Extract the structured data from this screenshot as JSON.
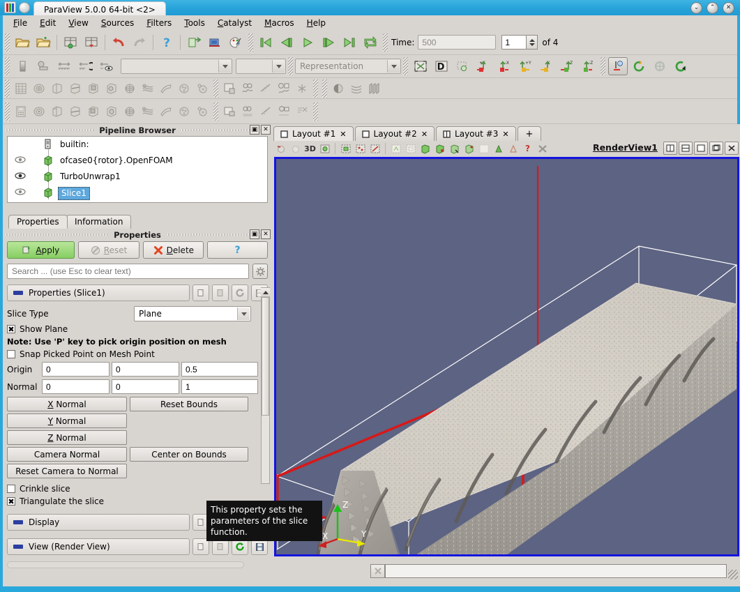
{
  "window": {
    "title": "ParaView 5.0.0 64-bit <2>",
    "buttons": {
      "minimize": "⌄",
      "maximize": "⌃",
      "close": "✕"
    }
  },
  "menu": {
    "items": [
      {
        "label": "File"
      },
      {
        "label": "Edit"
      },
      {
        "label": "View"
      },
      {
        "label": "Sources"
      },
      {
        "label": "Filters"
      },
      {
        "label": "Tools"
      },
      {
        "label": "Catalyst"
      },
      {
        "label": "Macros"
      },
      {
        "label": "Help"
      }
    ]
  },
  "toolbar": {
    "time_label": "Time:",
    "time_value": "500",
    "frame_value": "1",
    "frame_of": "of 4",
    "representation_placeholder": "Representation",
    "array_placeholder": "",
    "component_placeholder": ""
  },
  "pipeline": {
    "title": "Pipeline Browser",
    "items": [
      {
        "label": "builtin:",
        "eye": false,
        "selected": false
      },
      {
        "label": "ofcase0{rotor}.OpenFOAM",
        "eye": true,
        "selected": false
      },
      {
        "label": "TurboUnwrap1",
        "eye": true,
        "selected": false
      },
      {
        "label": "Slice1",
        "eye": true,
        "selected": true
      }
    ]
  },
  "panel_tabs": [
    {
      "label": "Properties",
      "active": true
    },
    {
      "label": "Information",
      "active": false
    }
  ],
  "properties": {
    "title": "Properties",
    "apply_label": "Apply",
    "reset_label": "Reset",
    "delete_label": "Delete",
    "help_label": "?",
    "search_placeholder": "Search ... (use Esc to clear text)",
    "sections": {
      "slice": "Properties (Slice1)",
      "display": "Display",
      "view": "View (Render View)"
    },
    "slice_type_label": "Slice Type",
    "slice_type_value": "Plane",
    "show_plane_label": "Show Plane",
    "show_plane_checked": true,
    "note": "Note: Use 'P' key to pick origin position on mesh",
    "snap_label": "Snap Picked Point on Mesh Point",
    "snap_checked": false,
    "origin_label": "Origin",
    "origin": [
      "0",
      "0",
      "0.5"
    ],
    "normal_label": "Normal",
    "normal": [
      "0",
      "0",
      "1"
    ],
    "buttons": {
      "x_normal": "X Normal",
      "y_normal": "Y Normal",
      "z_normal": "Z Normal",
      "camera_normal": "Camera Normal",
      "reset_camera_to_normal": "Reset Camera to Normal",
      "reset_bounds": "Reset Bounds",
      "center_on_bounds": "Center on Bounds"
    },
    "crinkle_label": "Crinkle slice",
    "crinkle_checked": false,
    "triangulate_label": "Triangulate the slice",
    "triangulate_checked": true
  },
  "tooltip": {
    "text": "This property sets the parameters of the slice function."
  },
  "layout": {
    "tabs": [
      {
        "label": "Layout #1",
        "active": true,
        "close": "✕"
      },
      {
        "label": "Layout #2",
        "active": false,
        "close": "✕"
      },
      {
        "label": "Layout #3",
        "active": false,
        "close": "✕"
      }
    ],
    "add_label": "+",
    "view_toolbar_3d": "3D",
    "view_toolbar_help": "?",
    "render_view_name": "RenderView1"
  },
  "scene": {
    "background_color": "#5d6382",
    "outline_color": "#ffffff",
    "plane_widget_color": "#d81818",
    "surface_color": "#cfc9c0",
    "axes": {
      "x": "X",
      "y": "Y",
      "z": "Z"
    },
    "axis_colors": {
      "x": "#d02020",
      "y": "#e8e800",
      "z": "#19c219"
    }
  },
  "colors": {
    "titlebar": "#29a8dc",
    "chrome": "#d8d4d0",
    "selection": "#5da8dd",
    "apply_green": "#86cf62",
    "viewport_border": "#1414e0"
  }
}
